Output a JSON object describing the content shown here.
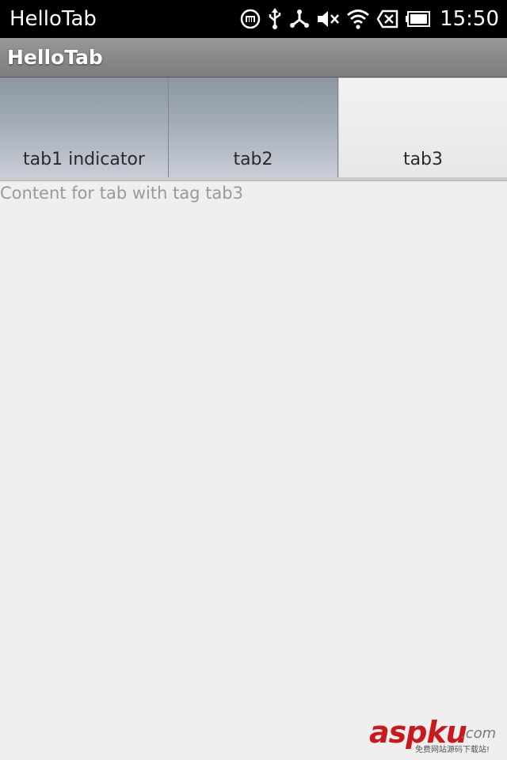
{
  "status_bar": {
    "app_name": "HelloTab",
    "time": "15:50",
    "icons": [
      "m-notification-icon",
      "usb-icon",
      "share-icon",
      "mute-icon",
      "wifi-icon",
      "no-signal-icon",
      "battery-icon"
    ]
  },
  "title_bar": {
    "title": "HelloTab"
  },
  "tabs": [
    {
      "label": "tab1 indicator",
      "selected": false
    },
    {
      "label": "tab2",
      "selected": false
    },
    {
      "label": "tab3",
      "selected": true
    }
  ],
  "content": {
    "text": "Content for tab with tag tab3"
  },
  "watermark": {
    "brand": "aspku",
    "domain": ".com",
    "tagline": "免费网站源码下载站!"
  },
  "colors": {
    "status_bar_bg": "#000000",
    "title_bar_bg": "#8a8a8a",
    "tab_unselected": "#a3acb8",
    "tab_selected": "#e6e7e9",
    "content_bg": "#efefef",
    "content_text": "#9a9a9a",
    "watermark_red": "#c9191e"
  }
}
